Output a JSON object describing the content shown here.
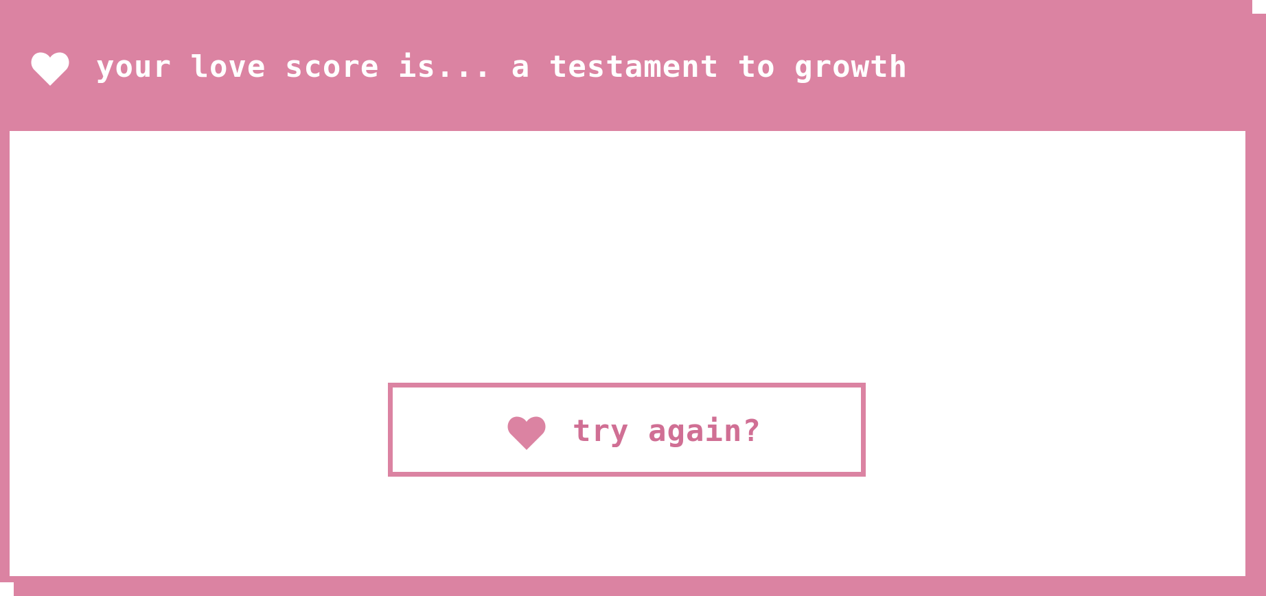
{
  "dialog": {
    "title": "your love score is... a testament to growth",
    "title_icon": "heart-icon",
    "retry_button": {
      "label": "try again?",
      "icon": "heart-icon"
    }
  },
  "colors": {
    "accent": "#db83a2",
    "accent_text": "#d06f94",
    "background": "#ffffff",
    "title_text": "#ffffff"
  }
}
